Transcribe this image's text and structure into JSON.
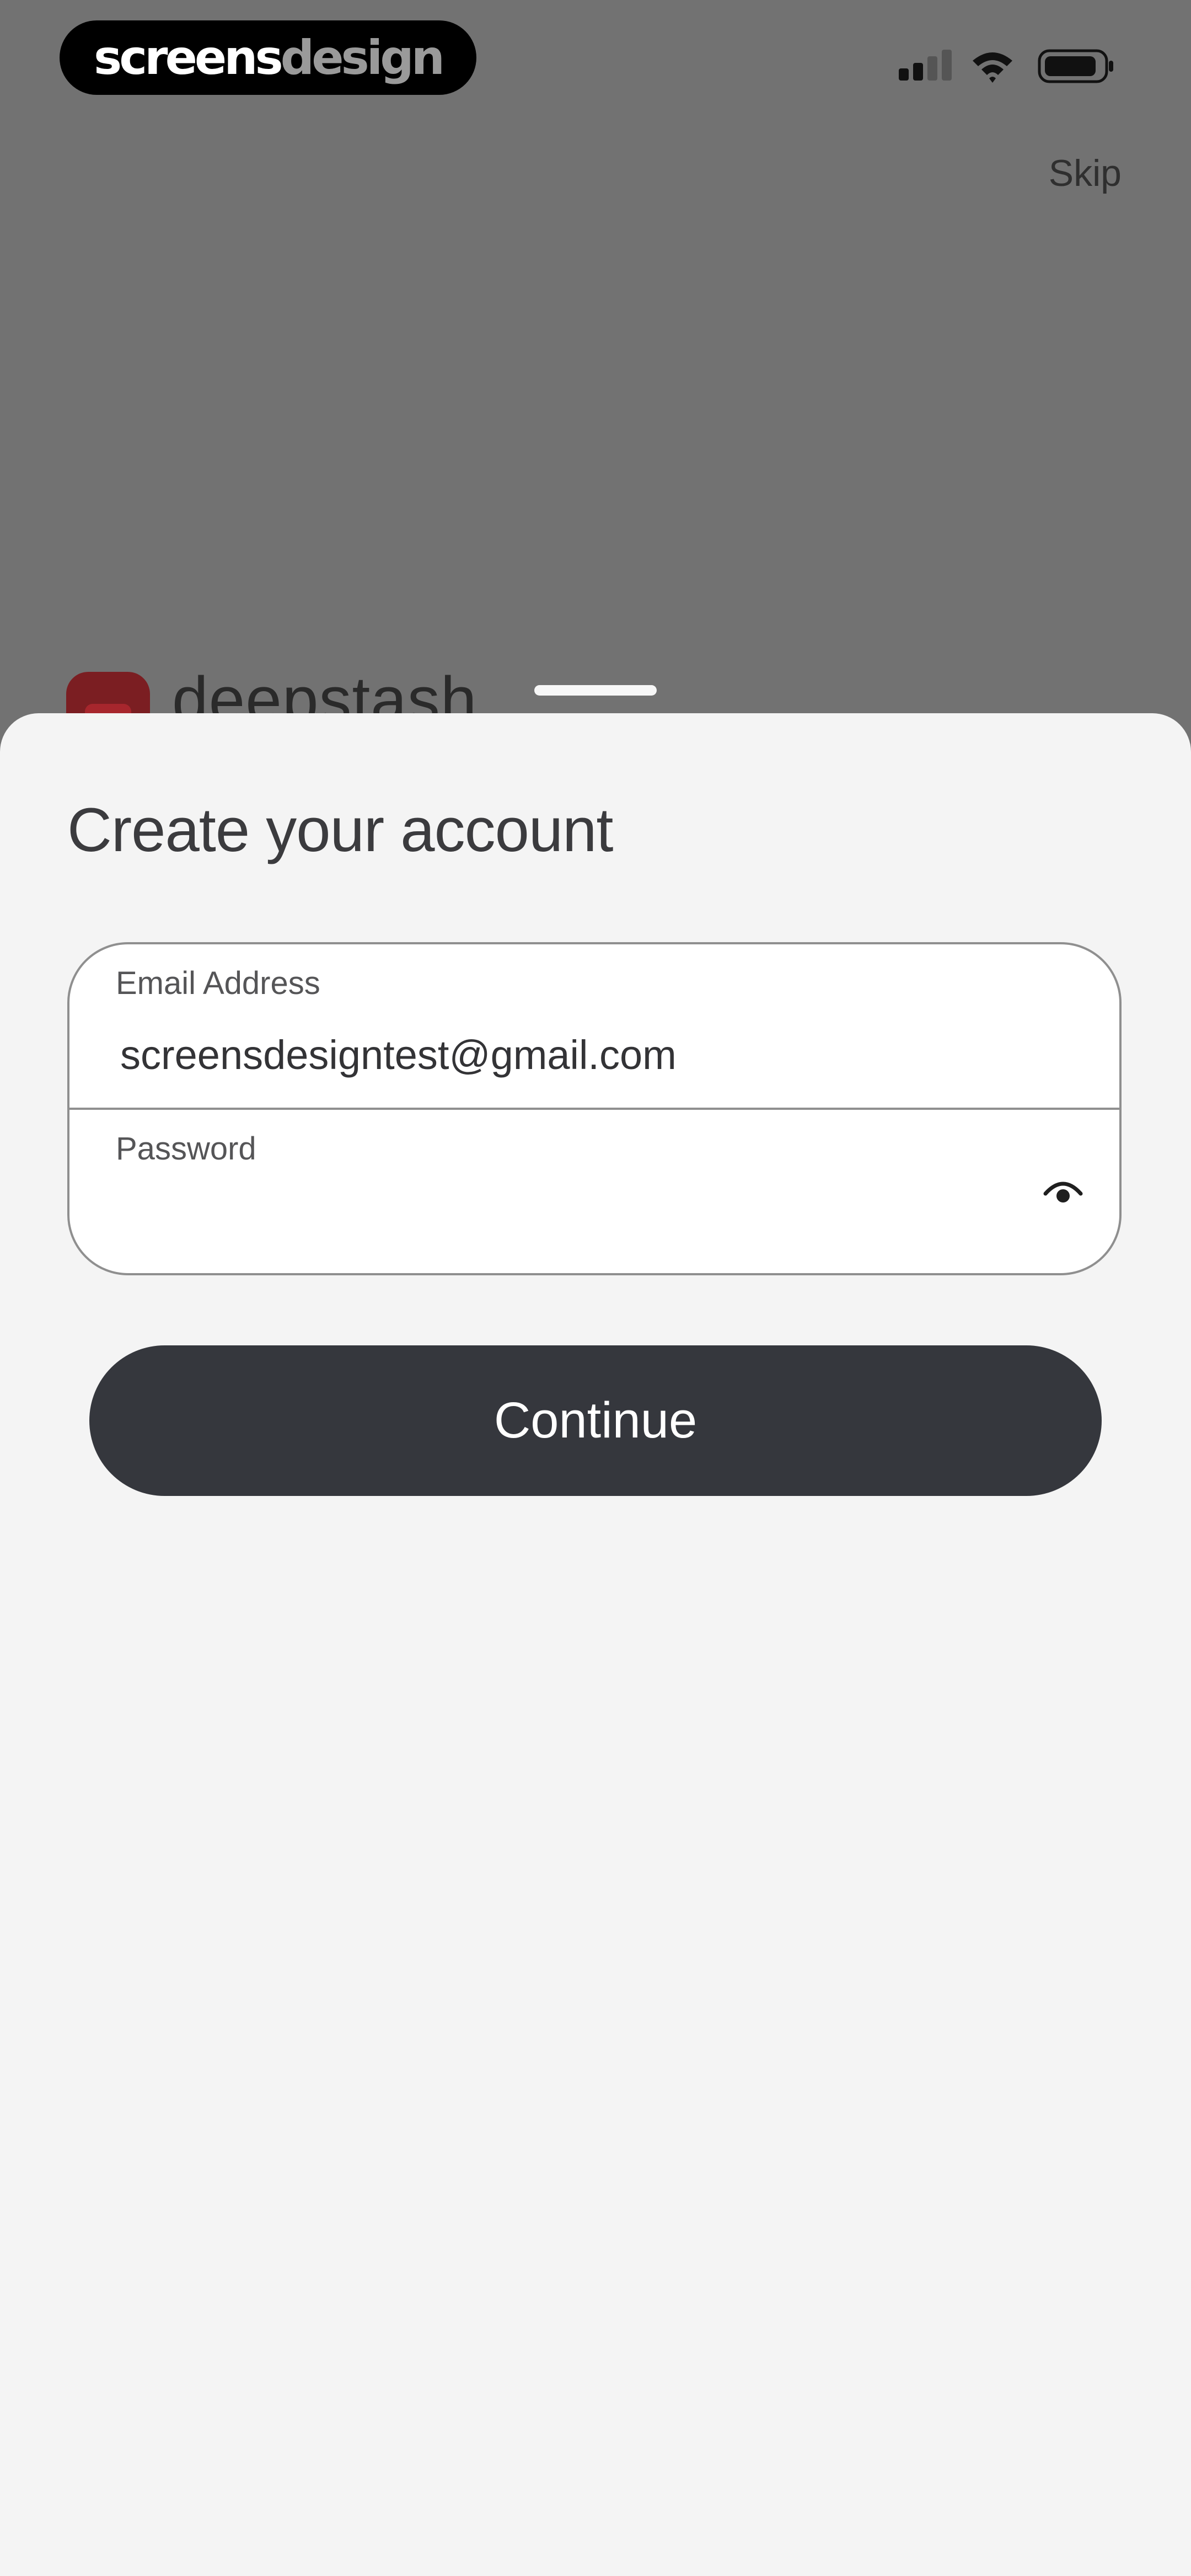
{
  "status_bar": {
    "brand_part1": "screens",
    "brand_part2": "design",
    "signal_icon": "signal-icon",
    "wifi_icon": "wifi-icon",
    "battery_icon": "battery-icon"
  },
  "top": {
    "skip_label": "Skip"
  },
  "background": {
    "app_name": "deepstash",
    "logo_color": "#7b1e22"
  },
  "sheet": {
    "title": "Create your account",
    "email": {
      "label": "Email Address",
      "value": "screensdesigntest@gmail.com"
    },
    "password": {
      "label": "Password",
      "value": "",
      "toggle_icon": "eye-icon"
    },
    "continue_label": "Continue"
  },
  "colors": {
    "overlay": "#727272",
    "sheet_bg": "#f4f4f4",
    "button_bg": "#35373d",
    "button_text": "#ffffff"
  }
}
